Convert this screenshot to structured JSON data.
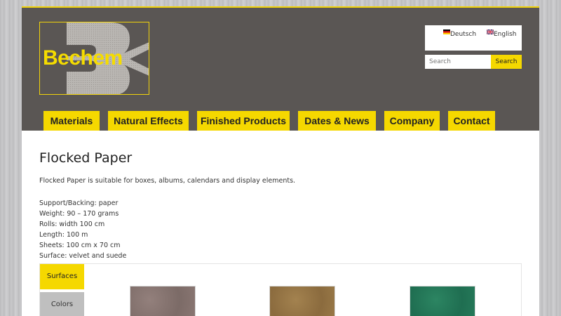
{
  "brand": {
    "logo_text": "Bechem"
  },
  "languages": [
    {
      "label": "Deutsch",
      "flag": "german-flag"
    },
    {
      "label": "English",
      "flag": "uk-flag"
    }
  ],
  "search": {
    "placeholder": "Search",
    "button_label": "Search"
  },
  "nav": [
    {
      "label": "Materials"
    },
    {
      "label": "Natural Effects"
    },
    {
      "label": "Finished Products"
    },
    {
      "label": "Dates & News"
    },
    {
      "label": "Company"
    },
    {
      "label": "Contact"
    }
  ],
  "main": {
    "title": "Flocked Paper",
    "intro": "Flocked Paper is suitable for boxes, albums, calendars and display elements.",
    "specs": [
      "Support/Backing: paper",
      "Weight: 90 – 170 grams",
      "Rolls: width 100 cm",
      "Length: 100 m",
      "Sheets: 100 cm x 70 cm",
      "Surface: velvet and suede"
    ]
  },
  "gallery": {
    "tabs": [
      {
        "label": "Surfaces",
        "active": true
      },
      {
        "label": "Colors",
        "active": false
      }
    ],
    "swatch_colors": [
      "#857270",
      "#957443",
      "#267a5a"
    ]
  },
  "colors": {
    "accent": "#f5d800",
    "header_bg": "#5a5654"
  }
}
